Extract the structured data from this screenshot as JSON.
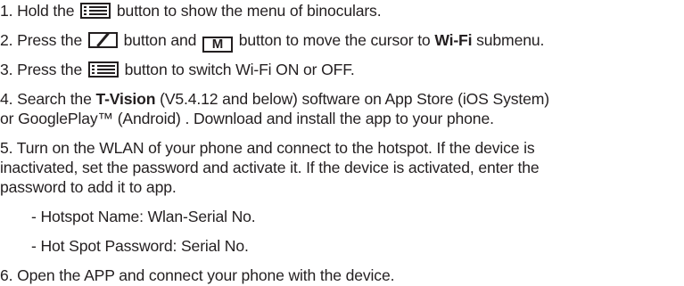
{
  "step1": {
    "before": "1. Hold the ",
    "icon": "menu-icon",
    "after": " button to show the menu of binoculars."
  },
  "step2": {
    "before": "2. Press the ",
    "icon1": "slash-icon",
    "middle": " button and ",
    "icon2": "m-button-icon",
    "icon2_letter": "M",
    "after": " button to move the cursor to ",
    "bold": "Wi-Fi",
    "end": " submenu."
  },
  "step3": {
    "before": "3. Press the ",
    "icon": "menu-icon",
    "after": " button to switch Wi-Fi ON or OFF."
  },
  "step4": {
    "line1_before": "4. Search the ",
    "line1_bold": "T-Vision",
    "line1_after": " (V5.4.12 and below) software on App Store (iOS System)",
    "line2": "or GooglePlay™ (Android) . Download and install the app to your phone."
  },
  "step5": {
    "line1": "5. Turn on the WLAN of your phone and connect to the hotspot. If the device is",
    "line2": "inactivated, set the password and activate it. If the device is activated, enter the",
    "line3": "password to add it to app.",
    "sub1": "- Hotspot Name: Wlan-Serial No.",
    "sub2": "- Hot Spot Password: Serial No."
  },
  "step6": {
    "text": "6. Open the APP and connect your phone with the device."
  }
}
